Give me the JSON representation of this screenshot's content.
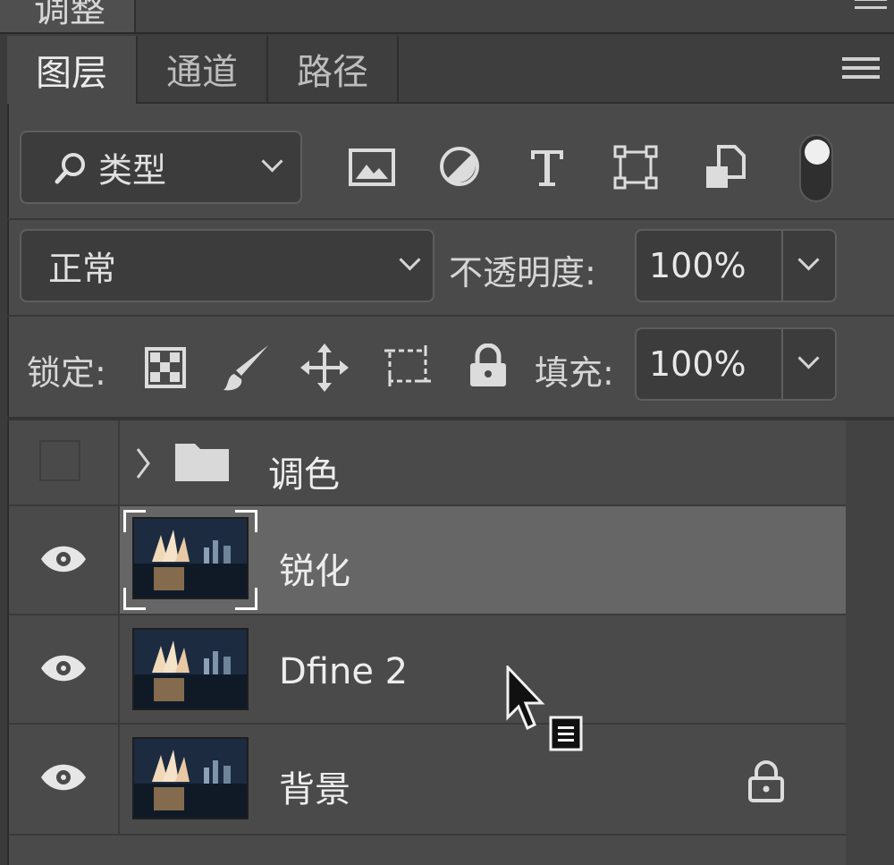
{
  "top_panel": {
    "tab_label": "调整"
  },
  "tabs": [
    {
      "label": "图层",
      "active": true
    },
    {
      "label": "通道",
      "active": false
    },
    {
      "label": "路径",
      "active": false
    }
  ],
  "filter": {
    "kind_label": "类型",
    "icons": [
      "image-filter-icon",
      "adjustment-filter-icon",
      "type-filter-icon",
      "shape-filter-icon",
      "smart-object-filter-icon",
      "filter-toggle-icon"
    ]
  },
  "blend": {
    "mode": "正常",
    "opacity_label": "不透明度:",
    "opacity_value": "100%"
  },
  "lock": {
    "label": "锁定:",
    "icons": [
      "lock-transparent-pixels-icon",
      "lock-image-pixels-icon",
      "lock-position-icon",
      "lock-artboard-icon",
      "lock-all-icon"
    ],
    "fill_label": "填充:",
    "fill_value": "100%"
  },
  "layers": [
    {
      "name": "调色",
      "type": "group",
      "visible": false,
      "selected": false
    },
    {
      "name": "锐化",
      "type": "pixel",
      "visible": true,
      "selected": true
    },
    {
      "name": "Dfine 2",
      "type": "pixel",
      "visible": true,
      "selected": false
    },
    {
      "name": "背景",
      "type": "pixel",
      "visible": true,
      "selected": false,
      "locked": true
    }
  ],
  "colors": {
    "panel_bg": "#4a4a4a",
    "selected_row": "#666666",
    "text": "#ededed"
  }
}
